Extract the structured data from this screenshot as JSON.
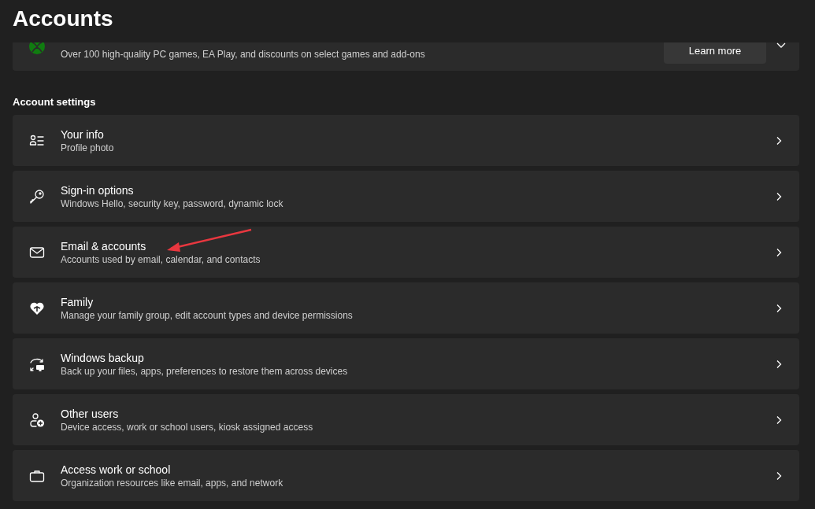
{
  "page_title": "Accounts",
  "promo_card": {
    "description": "Over 100 high-quality PC games, EA Play, and discounts on select games and add-ons",
    "button": "Learn more",
    "expanded": false
  },
  "section_title": "Account settings",
  "items": [
    {
      "kind": "info",
      "title": "Your info",
      "subtitle": "Profile photo"
    },
    {
      "kind": "key",
      "title": "Sign-in options",
      "subtitle": "Windows Hello, security key, password, dynamic lock"
    },
    {
      "kind": "mail",
      "title": "Email & accounts",
      "subtitle": "Accounts used by email, calendar, and contacts"
    },
    {
      "kind": "family",
      "title": "Family",
      "subtitle": "Manage your family group, edit account types and device permissions"
    },
    {
      "kind": "backup",
      "title": "Windows backup",
      "subtitle": "Back up your files, apps, preferences to restore them across devices"
    },
    {
      "kind": "users",
      "title": "Other users",
      "subtitle": "Device access, work or school users, kiosk assigned access"
    },
    {
      "kind": "work",
      "title": "Access work or school",
      "subtitle": "Organization resources like email, apps, and network"
    }
  ]
}
